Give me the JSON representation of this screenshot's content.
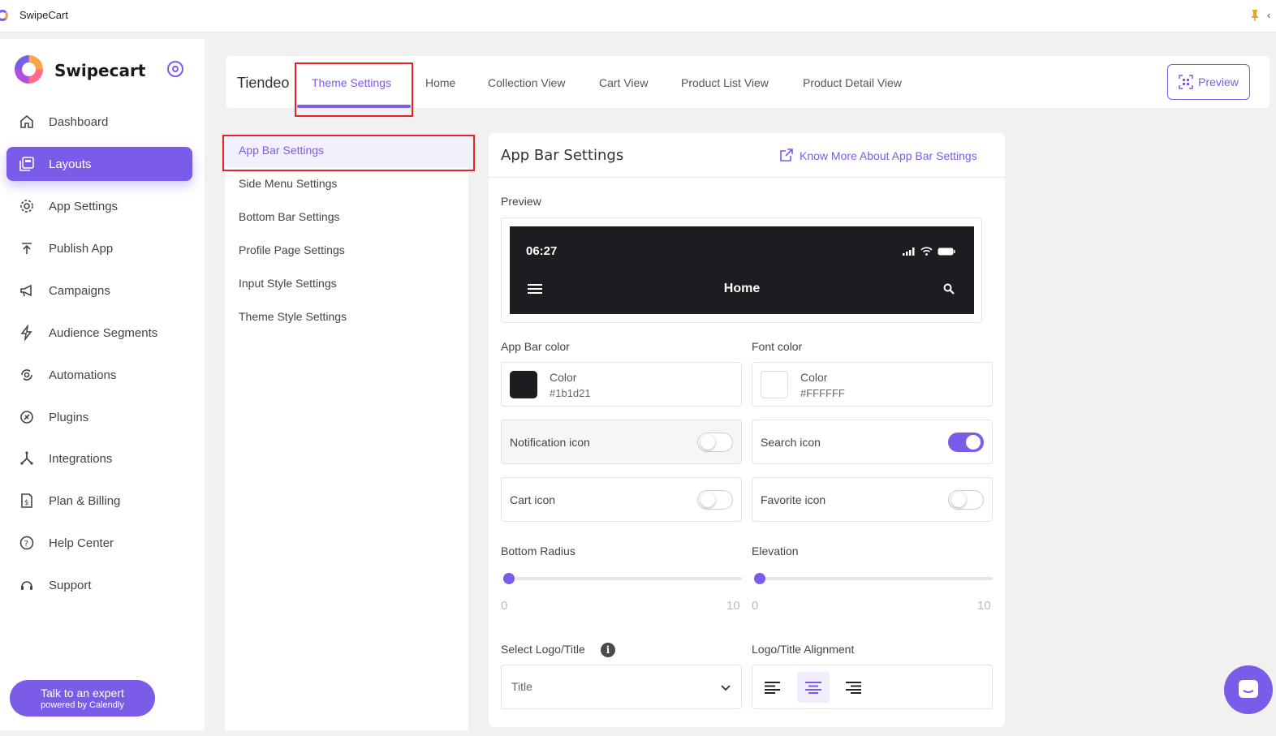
{
  "window": {
    "title": "SwipeCart"
  },
  "sidebar": {
    "brand": "Swipecart",
    "items": [
      {
        "label": "Dashboard",
        "icon": "home-icon"
      },
      {
        "label": "Layouts",
        "icon": "layouts-icon",
        "active": true
      },
      {
        "label": "App Settings",
        "icon": "gear-icon"
      },
      {
        "label": "Publish App",
        "icon": "publish-icon"
      },
      {
        "label": "Campaigns",
        "icon": "megaphone-icon"
      },
      {
        "label": "Audience Segments",
        "icon": "lightning-icon"
      },
      {
        "label": "Automations",
        "icon": "automation-icon"
      },
      {
        "label": "Plugins",
        "icon": "plugin-icon"
      },
      {
        "label": "Integrations",
        "icon": "integrations-icon"
      },
      {
        "label": "Plan & Billing",
        "icon": "billing-icon"
      },
      {
        "label": "Help Center",
        "icon": "help-icon"
      },
      {
        "label": "Support",
        "icon": "support-icon"
      }
    ],
    "expert": {
      "line1": "Talk to an expert",
      "line2": "powered by Calendly"
    }
  },
  "header": {
    "store": "Tiendeo",
    "tabs": [
      "Theme Settings",
      "Home",
      "Collection View",
      "Cart View",
      "Product List View",
      "Product Detail View"
    ],
    "active_tab": "Theme Settings",
    "preview_label": "Preview"
  },
  "settings_menu": {
    "items": [
      "App Bar Settings",
      "Side Menu Settings",
      "Bottom Bar Settings",
      "Profile Page Settings",
      "Input Style Settings",
      "Theme Style Settings"
    ],
    "active": "App Bar Settings"
  },
  "panel": {
    "title": "App Bar Settings",
    "know_more": "Know More About App Bar Settings",
    "preview_label": "Preview",
    "phone": {
      "time": "06:27",
      "title": "Home"
    },
    "app_bar_color": {
      "label": "App Bar color",
      "title": "Color",
      "value": "#1b1d21",
      "swatch": "#1b1d21"
    },
    "font_color": {
      "label": "Font color",
      "title": "Color",
      "value": "#FFFFFF",
      "swatch": "#FFFFFF"
    },
    "toggles": {
      "notification": {
        "label": "Notification icon",
        "on": false
      },
      "search": {
        "label": "Search icon",
        "on": true
      },
      "cart": {
        "label": "Cart icon",
        "on": false
      },
      "favorite": {
        "label": "Favorite icon",
        "on": false
      }
    },
    "bottom_radius": {
      "label": "Bottom Radius",
      "min": "0",
      "max": "10",
      "value": 0
    },
    "elevation": {
      "label": "Elevation",
      "min": "0",
      "max": "10",
      "value": 0
    },
    "logo_title": {
      "label": "Select Logo/Title",
      "value": "Title",
      "info_icon": "info-icon"
    },
    "alignment": {
      "label": "Logo/Title Alignment",
      "options": [
        "left",
        "center",
        "right"
      ],
      "selected": "center"
    }
  },
  "colors": {
    "accent": "#7b5ce8",
    "highlight": "#e52222"
  }
}
